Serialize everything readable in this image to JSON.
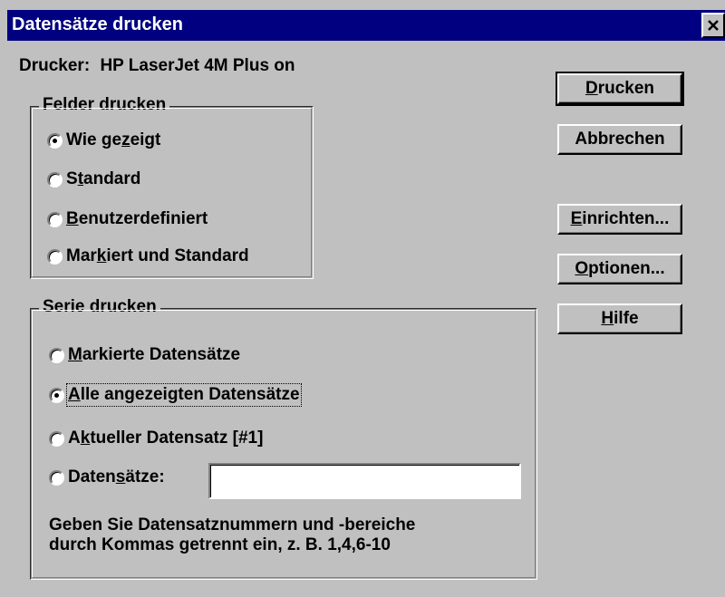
{
  "window": {
    "title": "Datensätze drucken"
  },
  "printer": {
    "label": "Drucker:",
    "name": "HP LaserJet 4M Plus on"
  },
  "print_fields": {
    "legend": "Felder drucken",
    "options": [
      {
        "pre": "Wie ge",
        "key": "z",
        "post": "eigt",
        "checked": true
      },
      {
        "pre": "S",
        "key": "t",
        "post": "andard",
        "checked": false
      },
      {
        "pre": "",
        "key": "B",
        "post": "enutzerdefiniert",
        "checked": false
      },
      {
        "pre": "Mar",
        "key": "k",
        "post": "iert und Standard",
        "checked": false
      }
    ]
  },
  "print_series": {
    "legend": "Serie drucken",
    "options": [
      {
        "pre": "",
        "key": "M",
        "post": "arkierte Datensätze",
        "checked": false
      },
      {
        "pre": "",
        "key": "A",
        "post": "lle angezeigten Datensätze",
        "checked": true
      },
      {
        "pre": "A",
        "key": "k",
        "post": "tueller Datensatz [#1]",
        "checked": false
      },
      {
        "pre": "Daten",
        "key": "s",
        "post": "ätze:",
        "checked": false
      }
    ],
    "records_value": "",
    "hint_line1": "Geben Sie Datensatznummern und -bereiche",
    "hint_line2": "durch Kommas getrennt ein, z. B. 1,4,6-10"
  },
  "buttons": {
    "print": {
      "pre": "",
      "key": "D",
      "post": "rucken"
    },
    "cancel": {
      "pre": "Abbrechen",
      "key": "",
      "post": ""
    },
    "setup": {
      "pre": "",
      "key": "E",
      "post": "inrichten..."
    },
    "options": {
      "pre": "",
      "key": "O",
      "post": "ptionen..."
    },
    "help": {
      "pre": "",
      "key": "H",
      "post": "ilfe"
    }
  }
}
